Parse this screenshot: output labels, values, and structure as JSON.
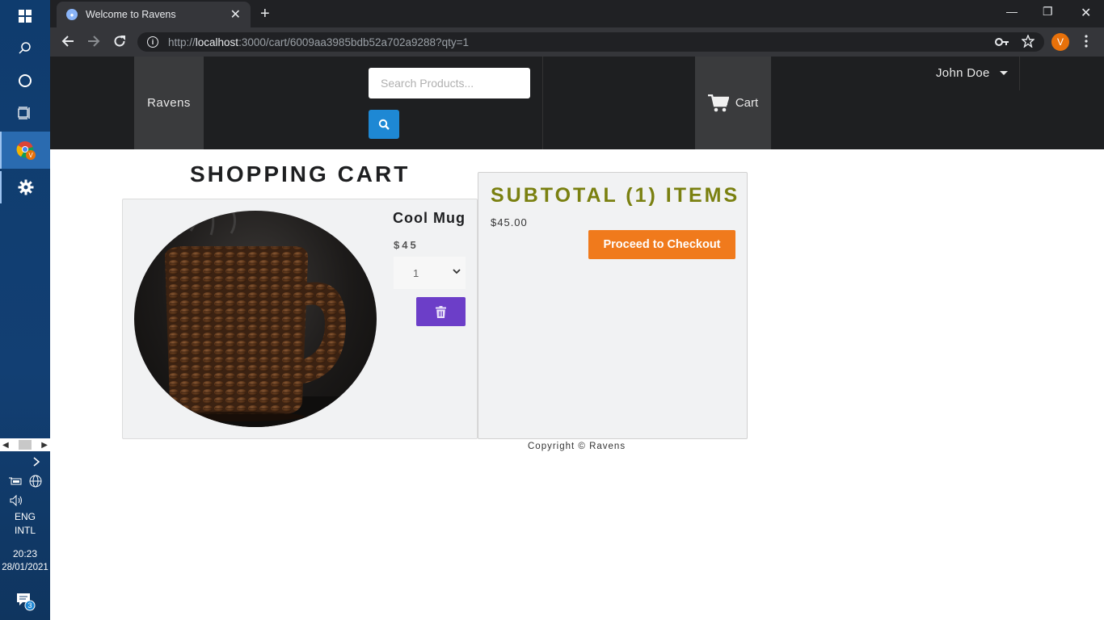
{
  "taskbar": {
    "language_line1": "ENG",
    "language_line2": "INTL",
    "time": "20:23",
    "date": "28/01/2021",
    "notification_count": "3"
  },
  "browser": {
    "tab_title": "Welcome to Ravens",
    "url_scheme": "http://",
    "url_host": "localhost",
    "url_rest": ":3000/cart/6009aa3985bdb52a702a9288?qty=1",
    "profile_initial": "V"
  },
  "navbar": {
    "brand": "Ravens",
    "search_placeholder": "Search Products...",
    "cart_label": "Cart",
    "user_name": "John Doe"
  },
  "cart": {
    "title": "SHOPPING CART",
    "items": [
      {
        "name": "Cool Mug",
        "price": "$45",
        "qty": "1"
      }
    ]
  },
  "summary": {
    "title": "SUBTOTAL (1) ITEMS",
    "total": "$45.00",
    "checkout_label": "Proceed to Checkout"
  },
  "footer": {
    "copyright": "Copyright © Ravens"
  },
  "colors": {
    "navbar_bg": "#1e1f21",
    "search_button": "#1e88d4",
    "delete_button": "#6c3ec8",
    "checkout_button": "#f07a1c",
    "subtotal_title": "#7a8010"
  }
}
